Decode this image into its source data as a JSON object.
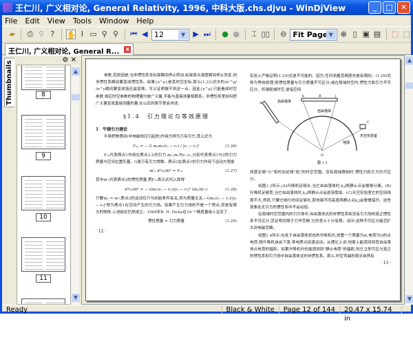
{
  "window": {
    "title": "王仁川, 广义相对论, General Relativity, 1996, 中科大版.chs.djvu - WinDjView",
    "minimize": "_",
    "maximize": "□",
    "close": "✕"
  },
  "menu": [
    "File",
    "Edit",
    "View",
    "Tools",
    "Window",
    "Help"
  ],
  "toolbar": {
    "page_value": "12",
    "zoom_value": "Fit Page"
  },
  "tab": {
    "label": "王仁川, 广义相对论, General R...",
    "close": "x"
  },
  "sidebar": {
    "tab_label": "Thumbnails",
    "gear": "⚙",
    "close": "✕",
    "thumbnails": [
      "8",
      "9",
      "10",
      "11"
    ]
  },
  "page": {
    "left": {
      "para1": "参数,其原因是:当非惯性系坐标架瞬间停止转动,标架原点速度瞬间停止改变,则非惯性系瞬间要变成惯性系。如果{x^μ}是其时空坐标,那么(1.23)式中的∂x'^μ/∂x^ν瞬间要变成洛伦兹变换。可以证明做不到这一点。因此{x^μ}只能看成时空参数,相应时空参数的物理量均是广义量,不能与直接测量相联系。非惯性系里如何把广义量变成直接测量的量,在以后的章节里会详述。",
      "heading": "§1.4　引力理论与等效原理",
      "sub": "1　牛顿引力理论",
      "para2": "牛顿把物质间(非电磁效应引起的)作用力称为万有引力,其公式为",
      "eq26": "F₁₂ = − G m₁m₂(r₂ − r₁) / |r₂ − r₁|³",
      "eq26n": "(1.26)",
      "para3": "F₁₂代表质点1作用在质点2上的引力,m₁,m₂与r₁,r₂,分别代表质点1与2的引力质量与空间位置矢量。G是万有引力常数。质点2在质点1的引力作用下运动方程是",
      "eq27": "m'₂ d²r₂/dt² = F₁₂",
      "eq27n": "(1.27)",
      "para4": "其中m'₂代表质点2的惯性质量,把F₁₂表示式代入即得",
      "eq28": "d²r₂/dt² = − Gm₁(r₂ − r₁)/|r₂ − r₁|³ (m₂/m'₂)",
      "eq28n": "(1.28)",
      "para5": "只要m₂ = m'₂质点2的运动仅只与初始条件有关,而与质量无关,−Gm₁(r₂ − r₁)/|r₂ − r₁|³称为质点1在空间产生的引力场。如果产生引力场的不是一个质点,而是有限大的物体,上述结论仍然成立。1964年R. H. Dicke在10⁻¹¹精度量级上证实了",
      "eq29": "惯性质量 = 引力质量",
      "eq29n": "(1.29)",
      "page_no": "· 12 ·"
    },
    "right": {
      "para1": "实验上严格证明(1.29)式是不可能的。因为,任何测量其精度总是有限的。(1.29)式称为等效原理,即惯性质量与引力质量不可区分;或在局域时空内,惯性力和引力不可区分。所谓局域时空,是指空间",
      "fig_labels": {
        "left_box": "自由落体",
        "top_box": "自由落体",
        "lab": "天空实验室",
        "earth": "地球",
        "origin": "O",
        "k": "k",
        "B": "B",
        "j": "j",
        "A": "A",
        "C": "C"
      },
      "fig_caption": "图 1.3",
      "para2": "线度足够\"小\"和时间足够\"短\"的时空范围。没有局域限制时,惯性力和引力仍可区分。",
      "para3": "如图1.3所示,(A)升降机足够长,当它自由落体时,k,j两静止点会慢慢分离。(B)升降机足够宽,当它自由落体时,k,j两静止点会逐渐靠拢。(C)天空实验室它的空间线度不大,然而,只要它绕行时间足够长,距地面不同高度两静止点k,j会慢慢错开。这些现象在无引力的惯性系中不会出现。",
      "para4": "在局域时空范围内的引力场中,自由落体式的非惯性系和没有引力场的真正惯性系不可区分,其证明仅限于力学范畴,它的意义十分有限。试问:这种不可区分能否扩大到电磁范畴。",
      "para5": "如图1.4所示:在处于自由落体状态的升降机内,放置一个质量为m,电荷为Q的点电荷,随升降机自由下落,带电质点加速运动。从理论上讲,地面上能观测到其自由落体点电荷的辐射。如果升降机内也能观测到\"静止电荷\"的辐射,则它立即可区分真正的惯性系和引力场中自由落体式的非惯性系。那么,时空弯曲的观点自然有",
      "page_no": "· 13 ·"
    }
  },
  "status": {
    "ready": "Ready",
    "mode": "Black & White",
    "page": "Page 12 of 144",
    "size": "20.47 x 15.74 in"
  }
}
